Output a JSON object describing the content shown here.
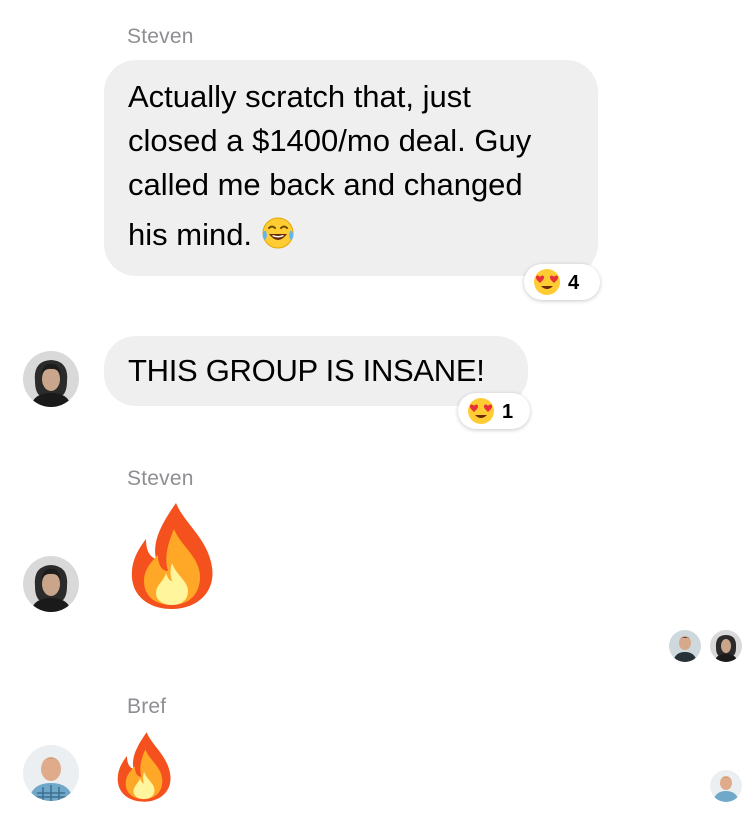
{
  "messages": [
    {
      "sender": "Steven",
      "lines": [
        "Actually scratch that, just",
        "closed a $1400/mo deal. Guy",
        "called me back and changed",
        "his mind."
      ],
      "trailing_emoji": "face-with-tears-of-joy-icon",
      "reaction": {
        "emoji": "heart-eyes-icon",
        "count": "4"
      }
    },
    {
      "sender": "",
      "text": "THIS GROUP IS INSANE!",
      "reaction": {
        "emoji": "heart-eyes-icon",
        "count": "1"
      }
    },
    {
      "sender": "Steven",
      "big_emoji": "fire-icon"
    },
    {
      "sender": "Bref",
      "big_emoji": "fire-icon"
    }
  ],
  "colors": {
    "bubble": "#efefef",
    "sender_name": "#8e8e93",
    "flame_outer": "#f4511e",
    "flame_mid": "#ffa726",
    "flame_core": "#fff59d"
  }
}
